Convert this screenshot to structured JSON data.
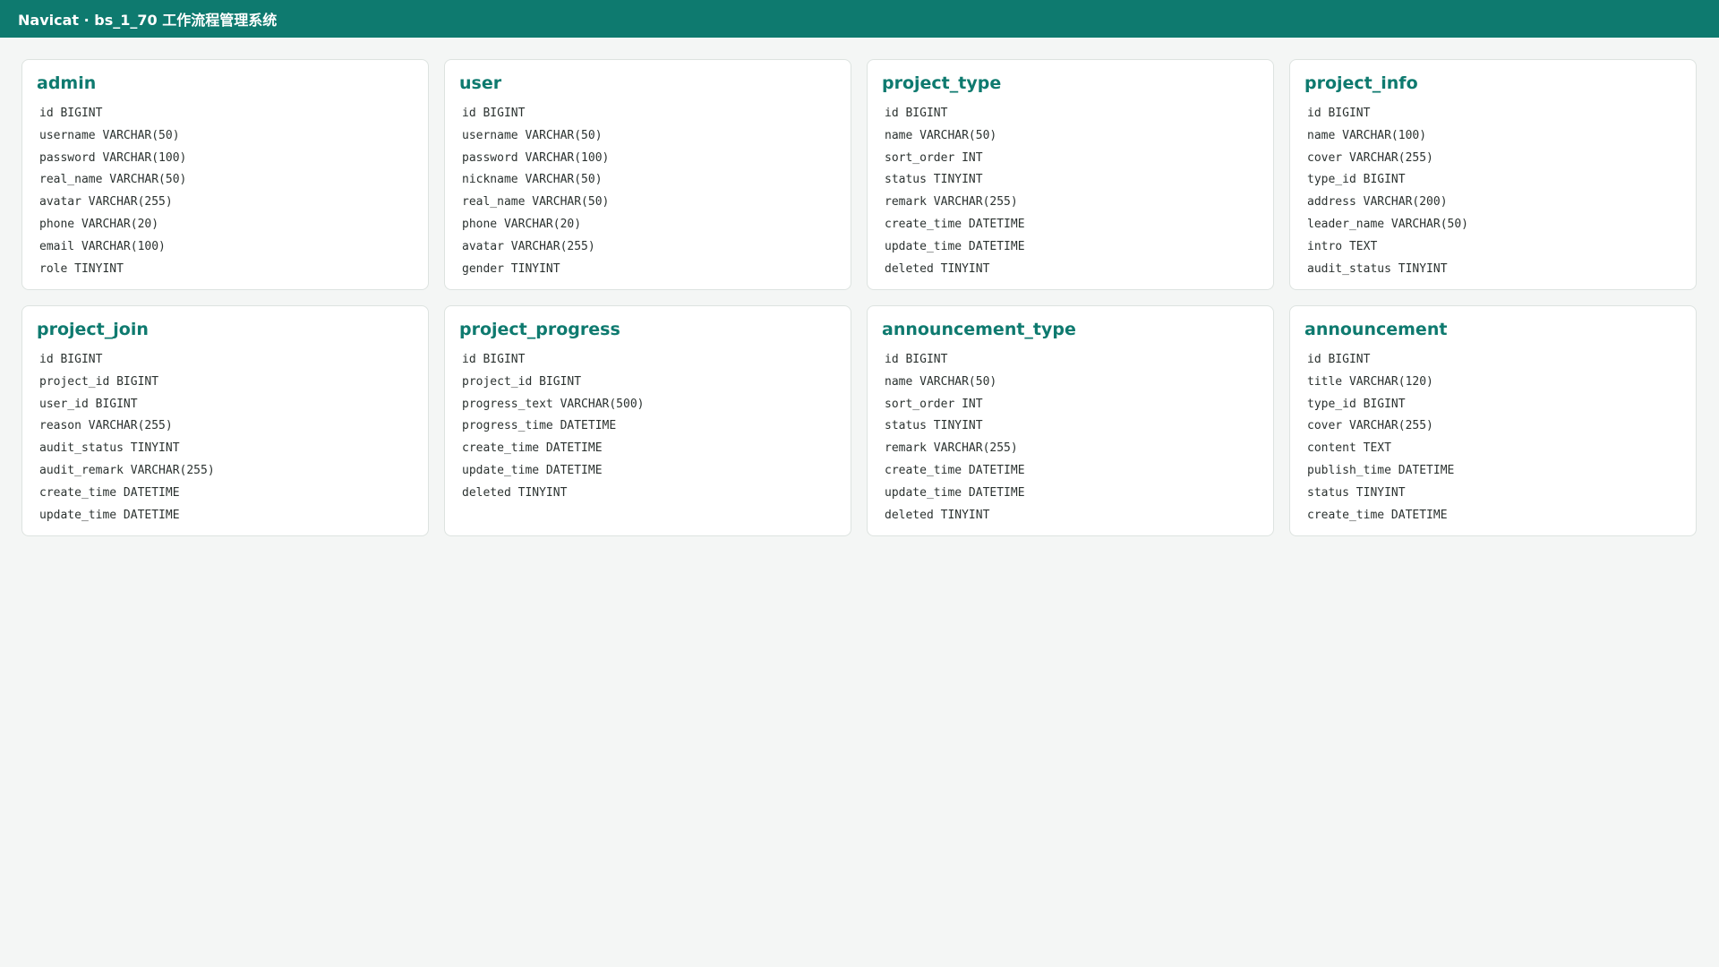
{
  "window": {
    "title": "Navicat · bs_1_70 工作流程管理系统"
  },
  "tables": [
    {
      "name": "admin",
      "fields": [
        "id BIGINT",
        "username VARCHAR(50)",
        "password VARCHAR(100)",
        "real_name VARCHAR(50)",
        "avatar VARCHAR(255)",
        "phone VARCHAR(20)",
        "email VARCHAR(100)",
        "role TINYINT"
      ]
    },
    {
      "name": "user",
      "fields": [
        "id BIGINT",
        "username VARCHAR(50)",
        "password VARCHAR(100)",
        "nickname VARCHAR(50)",
        "real_name VARCHAR(50)",
        "phone VARCHAR(20)",
        "avatar VARCHAR(255)",
        "gender TINYINT"
      ]
    },
    {
      "name": "project_type",
      "fields": [
        "id BIGINT",
        "name VARCHAR(50)",
        "sort_order INT",
        "status TINYINT",
        "remark VARCHAR(255)",
        "create_time DATETIME",
        "update_time DATETIME",
        "deleted TINYINT"
      ]
    },
    {
      "name": "project_info",
      "fields": [
        "id BIGINT",
        "name VARCHAR(100)",
        "cover VARCHAR(255)",
        "type_id BIGINT",
        "address VARCHAR(200)",
        "leader_name VARCHAR(50)",
        "intro TEXT",
        "audit_status TINYINT"
      ]
    },
    {
      "name": "project_join",
      "fields": [
        "id BIGINT",
        "project_id BIGINT",
        "user_id BIGINT",
        "reason VARCHAR(255)",
        "audit_status TINYINT",
        "audit_remark VARCHAR(255)",
        "create_time DATETIME",
        "update_time DATETIME"
      ]
    },
    {
      "name": "project_progress",
      "fields": [
        "id BIGINT",
        "project_id BIGINT",
        "progress_text VARCHAR(500)",
        "progress_time DATETIME",
        "create_time DATETIME",
        "update_time DATETIME",
        "deleted TINYINT"
      ]
    },
    {
      "name": "announcement_type",
      "fields": [
        "id BIGINT",
        "name VARCHAR(50)",
        "sort_order INT",
        "status TINYINT",
        "remark VARCHAR(255)",
        "create_time DATETIME",
        "update_time DATETIME",
        "deleted TINYINT"
      ]
    },
    {
      "name": "announcement",
      "fields": [
        "id BIGINT",
        "title VARCHAR(120)",
        "type_id BIGINT",
        "cover VARCHAR(255)",
        "content TEXT",
        "publish_time DATETIME",
        "status TINYINT",
        "create_time DATETIME"
      ]
    }
  ],
  "colors": {
    "accent": "#0e7a6f",
    "background": "#f4f6f5",
    "card": "#ffffff"
  }
}
